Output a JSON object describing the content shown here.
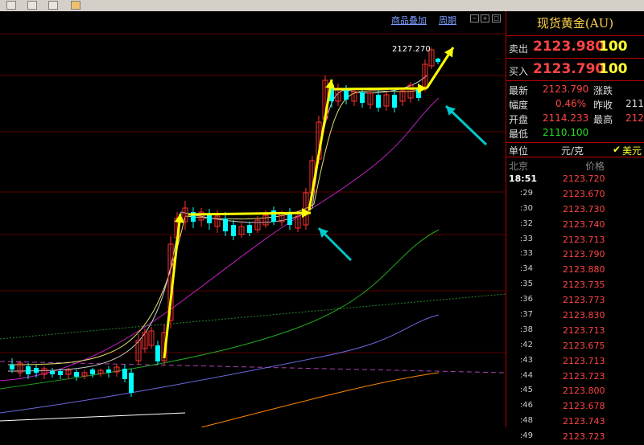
{
  "toolbar": {
    "icons": [
      "chart-icon",
      "image-icon",
      "stock-icon",
      "filter-icon",
      "calendar-icon"
    ]
  },
  "chart": {
    "links": {
      "overlay": "商品叠加",
      "period": "周期"
    },
    "high_label": "2127.270",
    "colors": {
      "up": "#ff3030",
      "down": "#00ffff",
      "arrow_yellow": "#ffff00",
      "arrow_cyan": "#00c8c8"
    }
  },
  "panel": {
    "title": "现货黄金(AU)",
    "sell": {
      "label": "卖出",
      "price": "2123.980",
      "volume": "100"
    },
    "buy": {
      "label": "买入",
      "price": "2123.790",
      "volume": "100"
    },
    "stats": {
      "latest_label": "最新",
      "latest": "2123.790",
      "change_label": "涨跌",
      "amplitude_label": "幅度",
      "amplitude": "0.46%",
      "prev_close_label": "昨收",
      "prev_close": "211",
      "open_label": "开盘",
      "open": "2114.233",
      "high_label": "最高",
      "high": "212",
      "low_label": "最低",
      "low": "2110.100"
    },
    "unit_label": "单位",
    "unit": "元/克",
    "currency": "美元",
    "ticks_header": {
      "location": "北京",
      "price": "价格"
    },
    "ticks": [
      {
        "time": "18:51",
        "price": "2123.720"
      },
      {
        "time": ":29",
        "price": "2123.670"
      },
      {
        "time": ":30",
        "price": "2123.730"
      },
      {
        "time": ":32",
        "price": "2123.740"
      },
      {
        "time": ":33",
        "price": "2123.713"
      },
      {
        "time": ":33",
        "price": "2123.790"
      },
      {
        "time": ":34",
        "price": "2123.880"
      },
      {
        "time": ":35",
        "price": "2123.735"
      },
      {
        "time": ":36",
        "price": "2123.773"
      },
      {
        "time": ":37",
        "price": "2123.830"
      },
      {
        "time": ":38",
        "price": "2123.713"
      },
      {
        "time": ":42",
        "price": "2123.675"
      },
      {
        "time": ":43",
        "price": "2123.713"
      },
      {
        "time": ":44",
        "price": "2123.723"
      },
      {
        "time": ":45",
        "price": "2123.800"
      },
      {
        "time": ":46",
        "price": "2123.678"
      },
      {
        "time": ":48",
        "price": "2123.743"
      },
      {
        "time": ":49",
        "price": "2123.723"
      }
    ]
  }
}
